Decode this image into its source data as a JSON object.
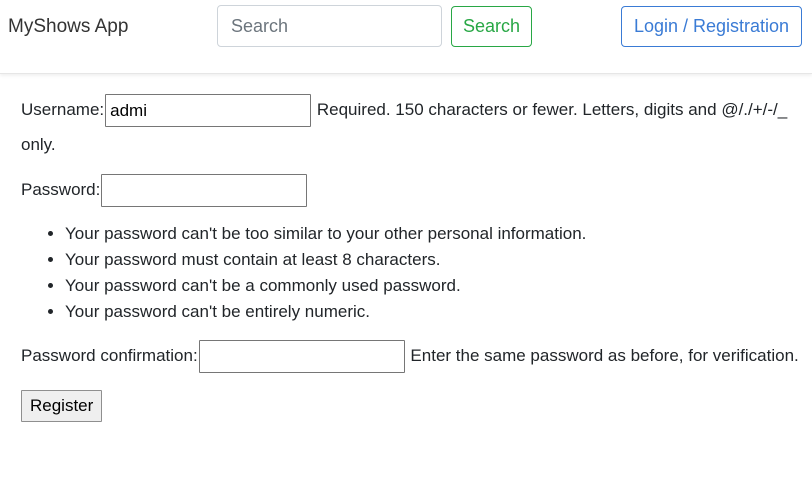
{
  "navbar": {
    "brand": "MyShows App",
    "search_placeholder": "Search",
    "search_button": "Search",
    "login_button": "Login / Registration",
    "colors": {
      "search_accent": "#28a745",
      "login_accent": "#3a7bd5"
    }
  },
  "form": {
    "username": {
      "label": "Username:",
      "value": "admi",
      "help": "Required. 150 characters or fewer. Letters, digits and @/./+/-/_ only."
    },
    "password": {
      "label": "Password:",
      "value": "",
      "rules": [
        "Your password can't be too similar to your other personal information.",
        "Your password must contain at least 8 characters.",
        "Your password can't be a commonly used password.",
        "Your password can't be entirely numeric."
      ]
    },
    "password_confirmation": {
      "label": "Password confirmation:",
      "value": "",
      "help": "Enter the same password as before, for verification."
    },
    "submit_label": "Register"
  }
}
